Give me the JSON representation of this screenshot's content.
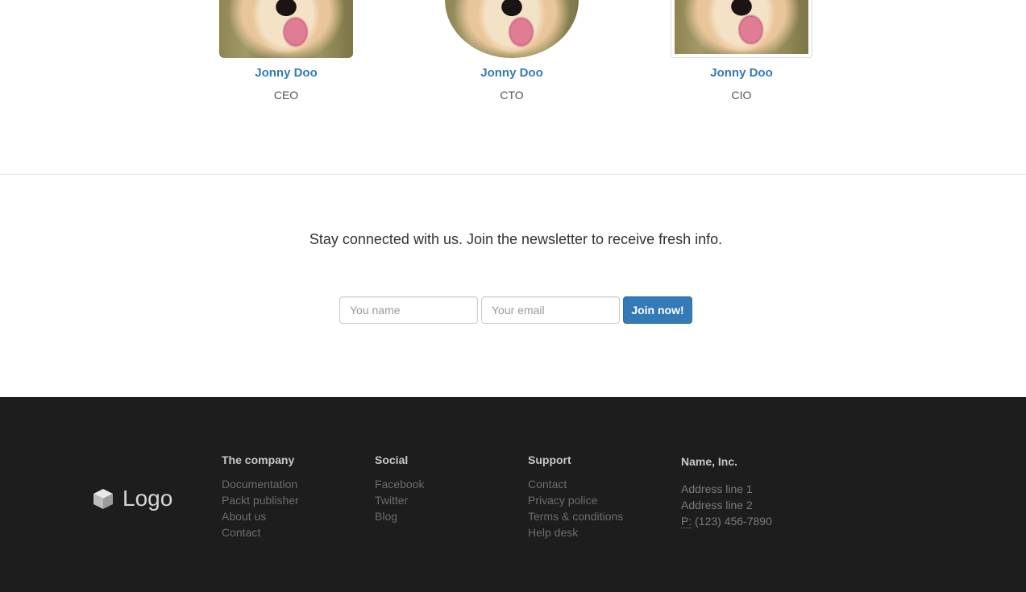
{
  "team": {
    "members": [
      {
        "name": "Jonny Doo",
        "role": "CEO"
      },
      {
        "name": "Jonny Doo",
        "role": "CTO"
      },
      {
        "name": "Jonny Doo",
        "role": "CIO"
      }
    ]
  },
  "newsletter": {
    "text": "Stay connected with us. Join the newsletter to receive fresh info.",
    "name_placeholder": "You name",
    "email_placeholder": "Your email",
    "button_label": "Join now!"
  },
  "footer": {
    "logo_text": "Logo",
    "columns": [
      {
        "heading": "The company",
        "links": [
          "Documentation",
          "Packt publisher",
          "About us",
          "Contact"
        ]
      },
      {
        "heading": "Social",
        "links": [
          "Facebook",
          "Twitter",
          "Blog"
        ]
      },
      {
        "heading": "Support",
        "links": [
          "Contact",
          "Privacy police",
          "Terms & conditions",
          "Help desk"
        ]
      }
    ],
    "address": {
      "company": "Name, Inc.",
      "line1": "Address line 1",
      "line2": "Address line 2",
      "phone_label": "P:",
      "phone": " (123) 456-7890"
    }
  },
  "colors": {
    "link_blue": "#337ab7",
    "footer_bg": "#1d1d1d",
    "button_bg": "#337ab7"
  }
}
